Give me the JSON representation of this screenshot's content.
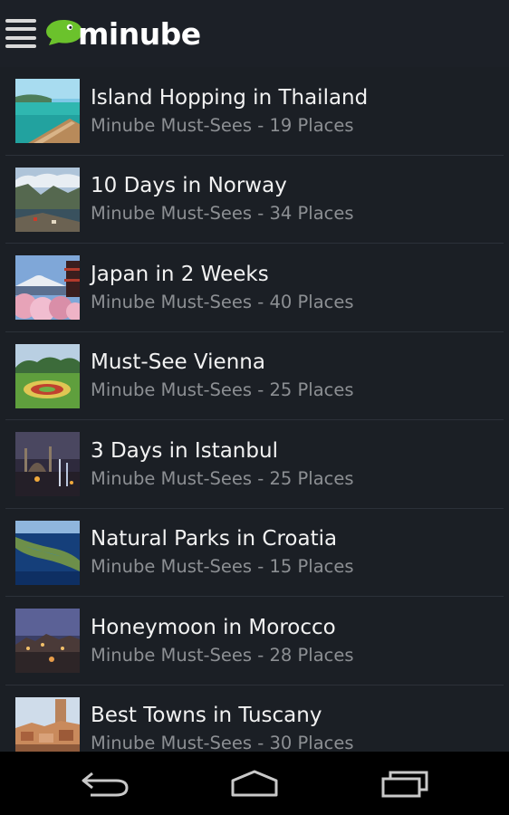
{
  "app": {
    "name": "minube"
  },
  "list": [
    {
      "title": "Island Hopping in Thailand",
      "subtitle": "Minube Must-Sees - 19 Places"
    },
    {
      "title": "10 Days in Norway",
      "subtitle": "Minube Must-Sees - 34 Places"
    },
    {
      "title": "Japan in 2 Weeks",
      "subtitle": "Minube Must-Sees - 40 Places"
    },
    {
      "title": "Must-See Vienna",
      "subtitle": "Minube Must-Sees - 25 Places"
    },
    {
      "title": "3 Days in Istanbul",
      "subtitle": "Minube Must-Sees - 25 Places"
    },
    {
      "title": "Natural Parks in Croatia",
      "subtitle": "Minube Must-Sees - 15 Places"
    },
    {
      "title": "Honeymoon in Morocco",
      "subtitle": "Minube Must-Sees - 28 Places"
    },
    {
      "title": "Best Towns in Tuscany",
      "subtitle": "Minube Must-Sees - 30 Places"
    }
  ],
  "icons": {
    "menu": "hamburger-menu-icon",
    "logo": "minube-cloud-logo",
    "back": "back-arrow-icon",
    "home": "home-icon",
    "recent": "recent-apps-icon"
  },
  "colors": {
    "background": "#1b1f25",
    "logo_green": "#6bc22c",
    "title_text": "#f2f2f2",
    "subtitle_text": "#8c8f93",
    "nav_bar": "#000000"
  }
}
